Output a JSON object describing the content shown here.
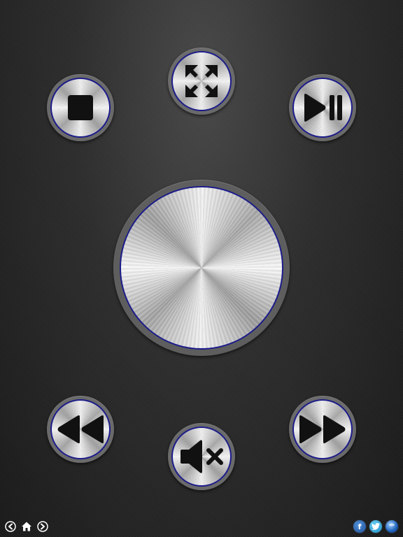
{
  "theme": {
    "background": "#2e2e2e",
    "button_rim": "#6a6a6a",
    "face_border": "#1c1c8a",
    "icon_color": "#111111"
  },
  "controls": {
    "stop": {
      "icon": "stop-icon"
    },
    "fullscreen": {
      "icon": "fullscreen-icon"
    },
    "play_pause": {
      "icon": "play-pause-icon"
    },
    "center": {
      "icon": "none"
    },
    "rewind": {
      "icon": "rewind-icon"
    },
    "mute": {
      "icon": "mute-icon"
    },
    "fast_forward": {
      "icon": "fast-forward-icon"
    }
  },
  "bottom_nav": {
    "back": {
      "icon": "arrow-left-icon"
    },
    "home": {
      "icon": "home-icon"
    },
    "forward": {
      "icon": "arrow-right-icon"
    }
  },
  "social": {
    "facebook": {
      "label": "f",
      "icon": "facebook-icon",
      "color": "#2a5db0"
    },
    "twitter": {
      "icon": "twitter-icon",
      "color": "#2aa3d8"
    },
    "globe": {
      "icon": "globe-icon",
      "color": "#1b5fb8"
    }
  }
}
